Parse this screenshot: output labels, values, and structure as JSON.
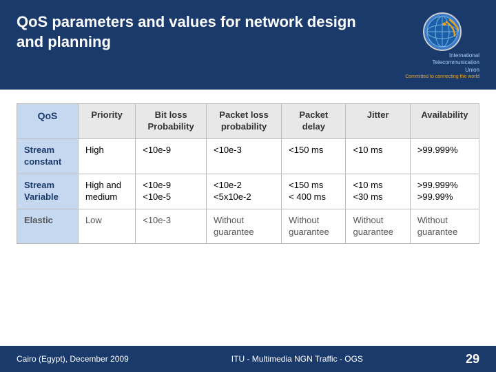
{
  "header": {
    "title": "QoS parameters and values for network design and planning"
  },
  "logo": {
    "org_line1": "International",
    "org_line2": "Telecommunication",
    "org_line3": "Union",
    "tagline": "Committed to connecting the world"
  },
  "table": {
    "columns": [
      "QoS",
      "Priority",
      "Bit loss Probability",
      "Packet loss probability",
      "Packet delay",
      "Jitter",
      "Availability"
    ],
    "rows": [
      {
        "qos": "Stream constant",
        "priority": "High",
        "bit_loss": "<10e-9",
        "packet_loss": "<10e-3",
        "packet_delay": "<150 ms",
        "jitter": "<10 ms",
        "availability": ">99.999%"
      },
      {
        "qos": "Stream Variable",
        "priority": "High and medium",
        "bit_loss": "<10e-9\n<10e-5",
        "packet_loss": "<10e-2\n<5x10e-2",
        "packet_delay": "<150 ms\n< 400 ms",
        "jitter": "<10 ms\n<30 ms",
        "availability": ">99.999%\n>99.99%"
      },
      {
        "qos": "Elastic",
        "priority": "Low",
        "bit_loss": "<10e-3",
        "packet_loss": "Without guarantee",
        "packet_delay": "Without guarantee",
        "jitter": "Without guarantee",
        "availability": "Without guarantee"
      }
    ]
  },
  "footer": {
    "left": "Cairo (Egypt),  December 2009",
    "center": "ITU - Multimedia NGN Traffic - OGS",
    "page": "29"
  }
}
